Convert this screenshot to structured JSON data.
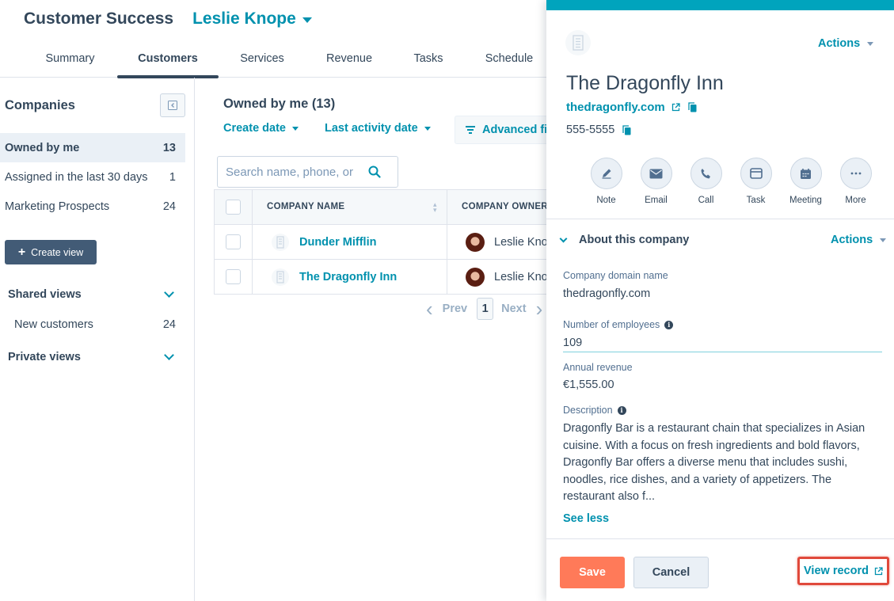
{
  "header": {
    "app_title": "Customer Success",
    "user_name": "Leslie Knope",
    "tabs": [
      {
        "label": "Summary"
      },
      {
        "label": "Customers"
      },
      {
        "label": "Services"
      },
      {
        "label": "Revenue"
      },
      {
        "label": "Tasks"
      },
      {
        "label": "Schedule"
      }
    ],
    "active_tab": "Customers"
  },
  "sidebar": {
    "title": "Companies",
    "views": [
      {
        "label": "Owned by me",
        "count": "13",
        "selected": true
      },
      {
        "label": "Assigned in the last 30 days",
        "count": "1",
        "selected": false
      },
      {
        "label": "Marketing Prospects",
        "count": "24",
        "selected": false
      }
    ],
    "create_view_label": "Create view",
    "shared_views_label": "Shared views",
    "shared_views": [
      {
        "label": "New customers",
        "count": "24"
      }
    ],
    "private_views_label": "Private views"
  },
  "main": {
    "list_title": "Owned by me (13)",
    "filters": {
      "create_date": "Create date",
      "last_activity_date": "Last activity date",
      "advanced_filters": "Advanced fi"
    },
    "search": {
      "placeholder": "Search name, phone, or",
      "value": ""
    },
    "table": {
      "columns": [
        "COMPANY NAME",
        "COMPANY OWNER"
      ],
      "rows": [
        {
          "company": "Dunder Mifflin",
          "owner": "Leslie Knope"
        },
        {
          "company": "The Dragonfly Inn",
          "owner": "Leslie Knope"
        }
      ]
    },
    "pagination": {
      "prev": "Prev",
      "page": "1",
      "next": "Next"
    }
  },
  "panel": {
    "accent_color": "#00a4bd",
    "actions_label": "Actions",
    "company_name": "The Dragonfly Inn",
    "domain": "thedragonfly.com",
    "phone": "555-5555",
    "activity_buttons": [
      {
        "label": "Note",
        "icon": "pencil-icon"
      },
      {
        "label": "Email",
        "icon": "envelope-icon"
      },
      {
        "label": "Call",
        "icon": "phone-icon"
      },
      {
        "label": "Task",
        "icon": "task-icon"
      },
      {
        "label": "Meeting",
        "icon": "calendar-icon"
      },
      {
        "label": "More",
        "icon": "more-icon"
      }
    ],
    "about": {
      "title": "About this company",
      "actions_label": "Actions",
      "domain_label": "Company domain name",
      "domain_value": "thedragonfly.com",
      "employees_label": "Number of employees",
      "employees_value": "109",
      "revenue_label": "Annual revenue",
      "revenue_value": "€1,555.00",
      "description_label": "Description",
      "description_value": "Dragonfly Bar is a restaurant chain that specializes in Asian cuisine. With a focus on fresh ingredients and bold flavors, Dragonfly Bar offers a diverse menu that includes sushi, noodles, rice dishes, and a variety of appetizers. The restaurant also f...",
      "see_less": "See less"
    },
    "footer": {
      "save": "Save",
      "cancel": "Cancel",
      "view_record": "View record"
    }
  }
}
